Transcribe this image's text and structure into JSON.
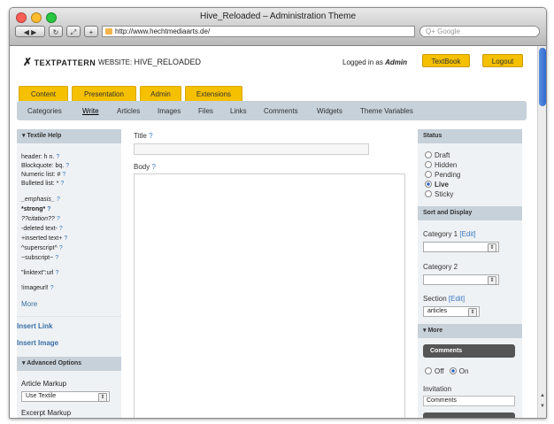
{
  "browser": {
    "title": "Hive_Reloaded – Administration Theme",
    "url": "http://www.hechtmediaarts.de/",
    "search_placeholder": "Q+ Google",
    "traffic_colors": [
      "#ff5f57",
      "#febc2e",
      "#28c840"
    ]
  },
  "header": {
    "logo_icon": "crossed-tools-icon",
    "logo": "TEXTPATTERN",
    "website_label": "WEBSITE:",
    "website_name": "HIVE_RELOADED",
    "logged_in_text": "Logged in as",
    "user": "Admin",
    "textbook_label": "TextBook",
    "logout_label": "Logout"
  },
  "tabs": [
    "Content",
    "Presentation",
    "Admin",
    "Extensions"
  ],
  "subnav": [
    "Categories",
    "Write",
    "Articles",
    "Images",
    "Files",
    "Links",
    "Comments",
    "Widgets",
    "Theme Variables"
  ],
  "subnav_active": "Write",
  "textile_help": {
    "title": "Textile Help",
    "lines": [
      {
        "text": "header: h n.",
        "q": "?"
      },
      {
        "text": "Blockquote: bq.",
        "q": "?"
      },
      {
        "text": "Numeric list: #",
        "q": "?"
      },
      {
        "text": "Bulleted list: *",
        "q": "?"
      },
      {
        "text": "_emphasis_",
        "q": "?"
      },
      {
        "text": "*strong*",
        "q": "?"
      },
      {
        "text": "??citation??",
        "q": "?"
      },
      {
        "text": "-deleted text-",
        "q": "?"
      },
      {
        "text": "+inserted text+",
        "q": "?"
      },
      {
        "text": "^superscript^",
        "q": "?"
      },
      {
        "text": "~subscript~",
        "q": "?"
      },
      {
        "text": "\"linktext\":url",
        "q": "?"
      },
      {
        "text": "!imageurl!",
        "q": "?"
      }
    ],
    "more": "More"
  },
  "insert_link": "Insert Link",
  "insert_image": "Insert Image",
  "advanced": {
    "title": "Advanced Options",
    "article_markup_label": "Article Markup",
    "article_markup_value": "Use Textile",
    "excerpt_markup_label": "Excerpt Markup"
  },
  "main": {
    "title_label": "Title",
    "body_label": "Body",
    "q": "?"
  },
  "status": {
    "title": "Status",
    "options": [
      "Draft",
      "Hidden",
      "Pending",
      "Live",
      "Sticky"
    ],
    "selected": "Live"
  },
  "sort_display": {
    "title": "Sort and Display",
    "category1_label": "Category 1",
    "edit_label": "[Edit]",
    "category2_label": "Category 2",
    "section_label": "Section",
    "section_value": "articles"
  },
  "more_panel": {
    "title": "More",
    "comments_button": "Comments",
    "off_label": "Off",
    "on_label": "On",
    "comments_selected": "On",
    "invitation_label": "Invitation",
    "invitation_value": "Comments"
  },
  "colors": {
    "accent_yellow": "#f5c000",
    "nav_blue_gray": "#c6d1da",
    "link_blue": "#3a6fa5"
  }
}
